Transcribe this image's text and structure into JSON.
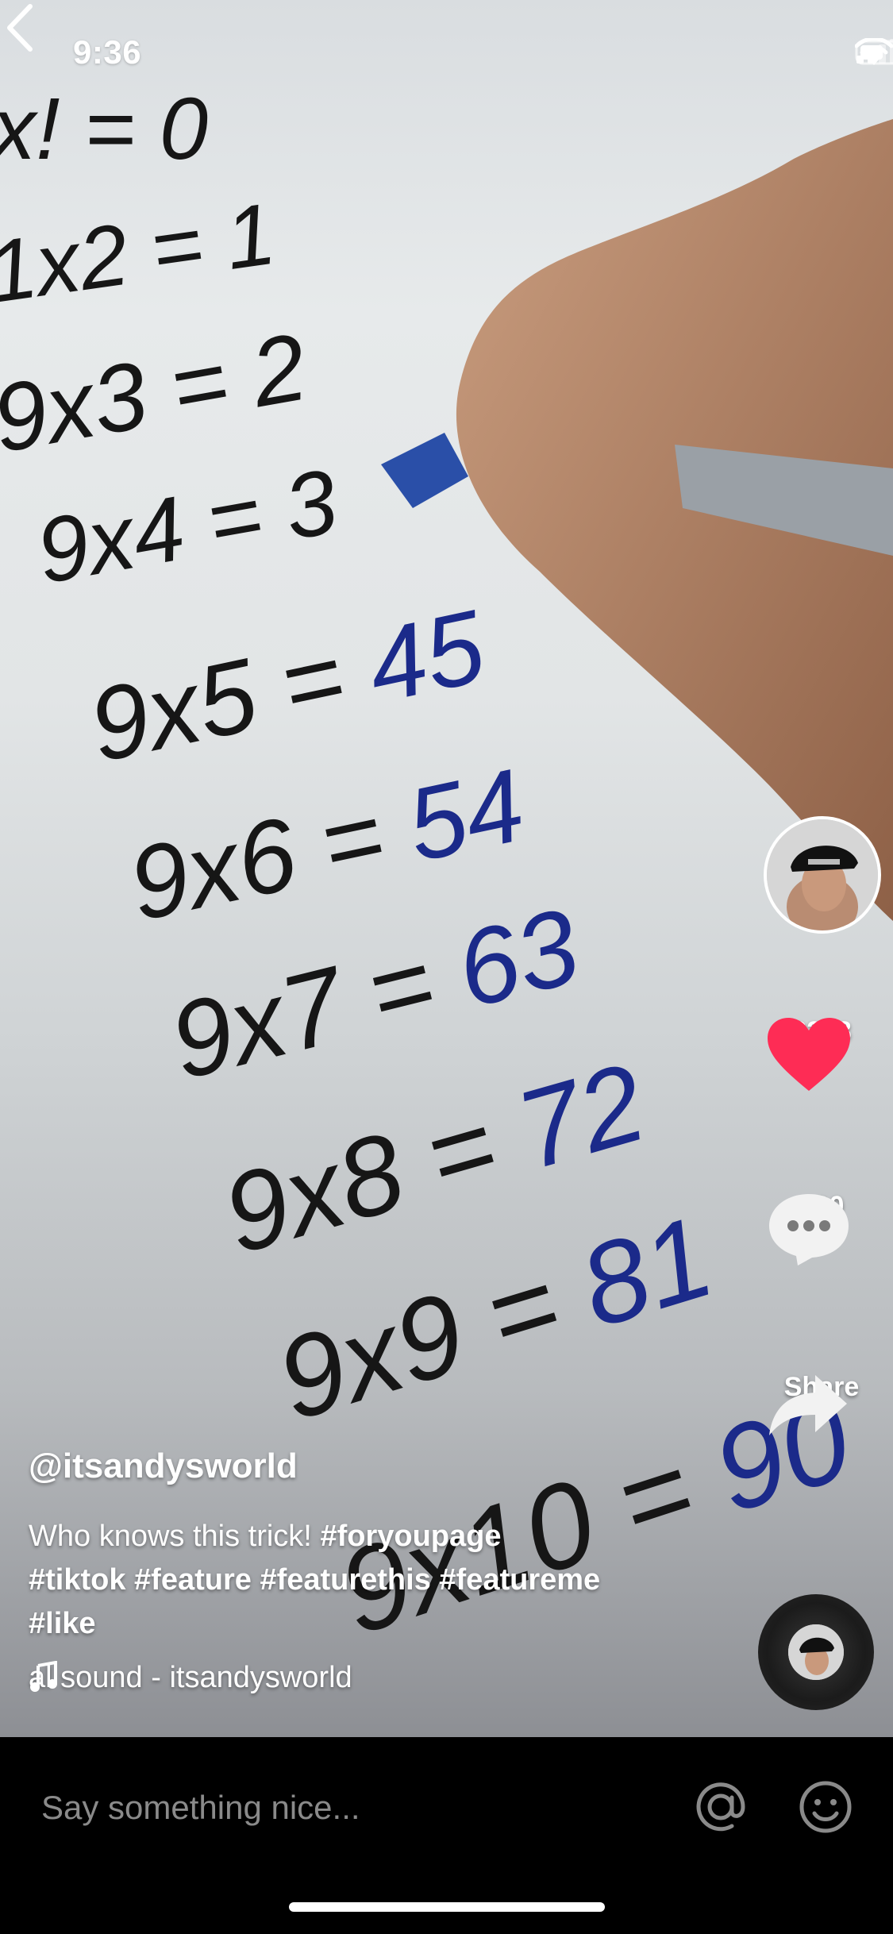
{
  "status_bar": {
    "time": "9:36"
  },
  "creator": {
    "username": "@itsandysworld"
  },
  "caption": {
    "text": "Who knows this trick!",
    "hashtags_line1": "#foryoupage",
    "hashtags_line2": "#tiktok #feature #featurethis #featureme",
    "hashtags_line3": "#like"
  },
  "music": {
    "label": "al sound - itsandysworld"
  },
  "actions": {
    "likes": "3258",
    "comments": "130",
    "share_label": "Share"
  },
  "comment_bar": {
    "placeholder": "Say something nice..."
  },
  "colors": {
    "like": "#fe2c55",
    "text": "#ffffff"
  },
  "icons": [
    "back-icon",
    "signal-icon",
    "wifi-icon",
    "battery-icon",
    "heart-icon",
    "comment-icon",
    "share-icon",
    "music-note-icon",
    "at-icon",
    "emoji-icon"
  ]
}
